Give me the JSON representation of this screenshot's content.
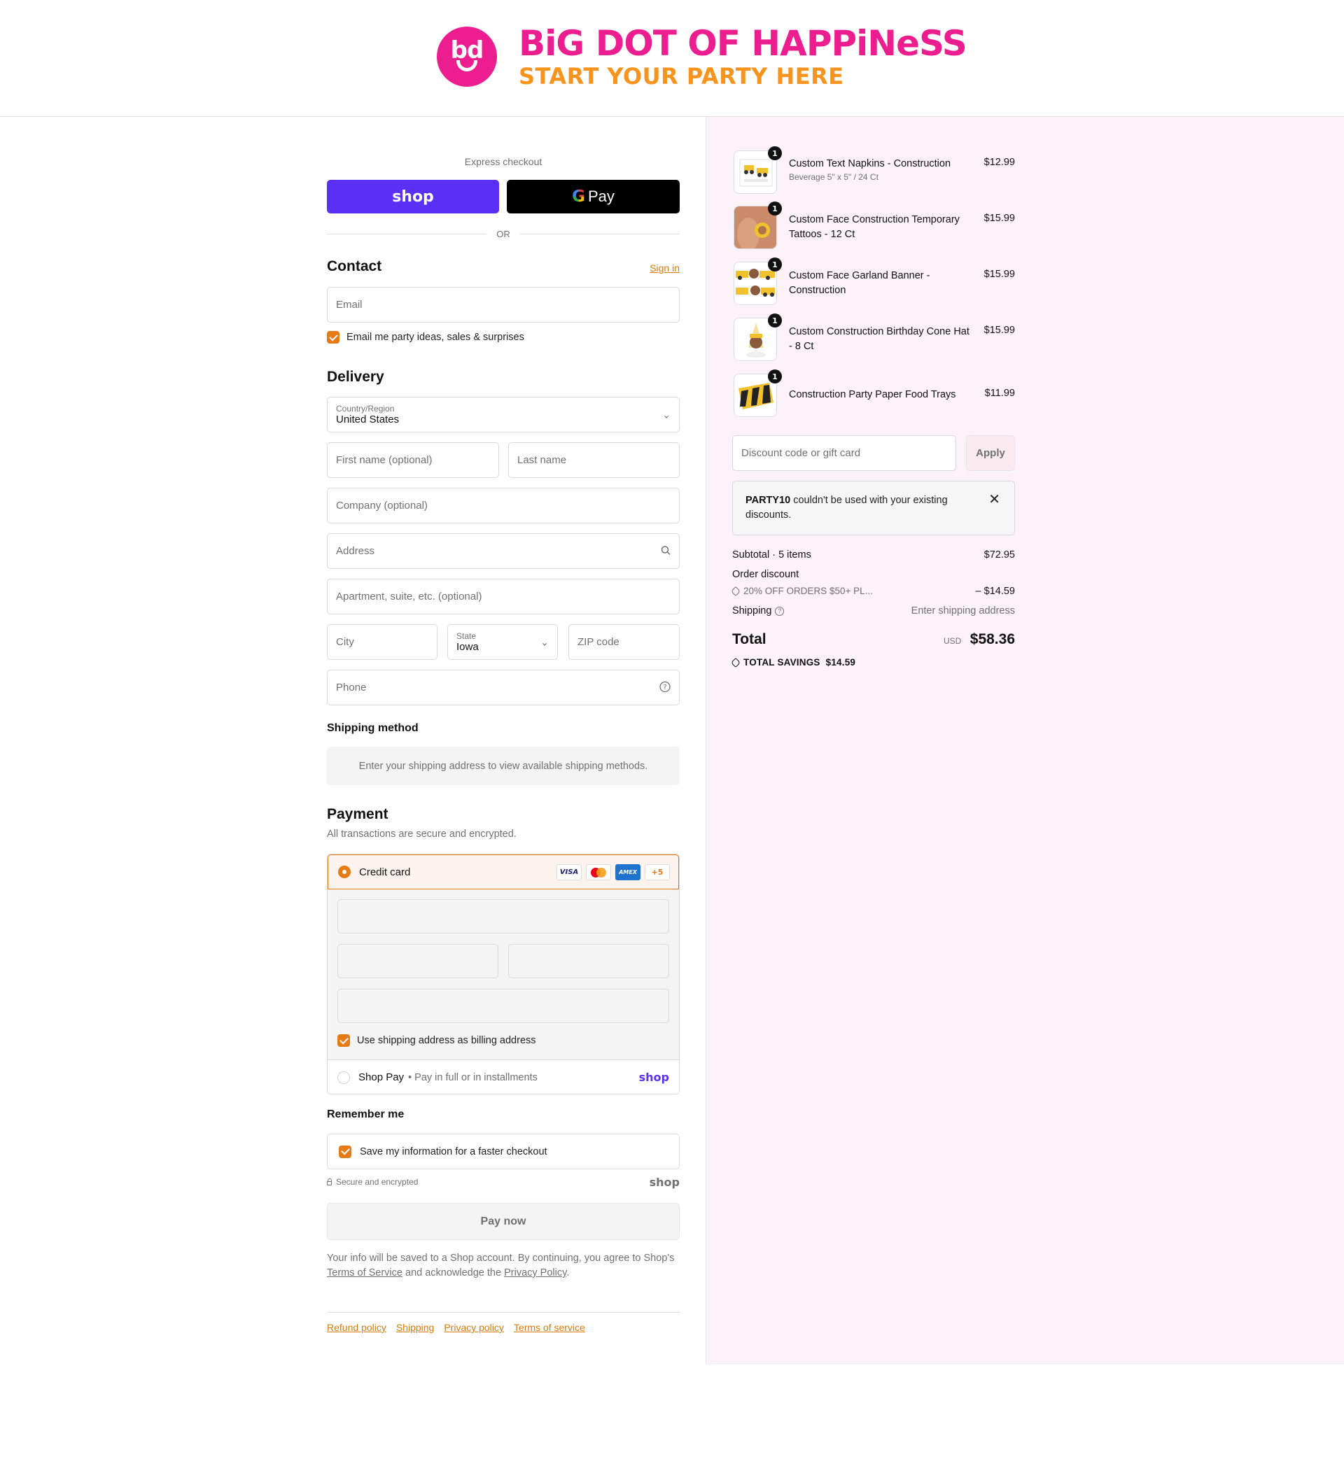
{
  "brand": {
    "logo_mark": "bd",
    "title": "BiG DOT OF HAPPiNeSS",
    "tagline": "START YOUR PARTY HERE",
    "pink": "#ec1e8f",
    "orange": "#f7941d"
  },
  "express": {
    "label": "Express checkout",
    "shop_button": "shop",
    "gpay_button": "Pay",
    "or": "OR"
  },
  "contact": {
    "heading": "Contact",
    "sign_in": "Sign in",
    "email_placeholder": "Email",
    "marketing_opt_in": "Email me party ideas, sales & surprises"
  },
  "delivery": {
    "heading": "Delivery",
    "country_label": "Country/Region",
    "country_value": "United States",
    "first_name": "First name (optional)",
    "last_name": "Last name",
    "company": "Company (optional)",
    "address": "Address",
    "apartment": "Apartment, suite, etc. (optional)",
    "city": "City",
    "state_label": "State",
    "state_value": "Iowa",
    "zip": "ZIP code",
    "phone": "Phone"
  },
  "shipping_method": {
    "heading": "Shipping method",
    "message": "Enter your shipping address to view available shipping methods."
  },
  "payment": {
    "heading": "Payment",
    "subtitle": "All transactions are secure and encrypted.",
    "credit_card": "Credit card",
    "cards": [
      "VISA",
      "mastercard",
      "AMEX",
      "+5"
    ],
    "billing_same": "Use shipping address as billing address",
    "shop_pay": "Shop Pay",
    "shop_pay_desc": "Pay in full or in installments",
    "shop_wordmark": "shop"
  },
  "remember": {
    "heading": "Remember me",
    "save_info": "Save my information for a faster checkout",
    "secure": "Secure and encrypted",
    "shop_wordmark": "shop"
  },
  "pay_now": "Pay now",
  "legal": {
    "prefix": "Your info will be saved to a Shop account. By continuing, you agree to Shop's ",
    "terms": "Terms of Service",
    "middle": " and acknowledge the ",
    "privacy": "Privacy Policy",
    "suffix": "."
  },
  "footer_links": [
    "Refund policy",
    "Shipping",
    "Privacy policy",
    "Terms of service"
  ],
  "cart": {
    "items": [
      {
        "name": "Custom Text Napkins - Construction",
        "variant": "Beverage 5\" x 5\" / 24 Ct",
        "price": "$12.99",
        "qty": "1"
      },
      {
        "name": "Custom Face Construction Temporary Tattoos - 12 Ct",
        "variant": "",
        "price": "$15.99",
        "qty": "1"
      },
      {
        "name": "Custom Face Garland Banner - Construction",
        "variant": "",
        "price": "$15.99",
        "qty": "1"
      },
      {
        "name": "Custom Construction Birthday Cone Hat - 8 Ct",
        "variant": "",
        "price": "$15.99",
        "qty": "1"
      },
      {
        "name": "Construction Party Paper Food Trays",
        "variant": "",
        "price": "$11.99",
        "qty": "1"
      }
    ],
    "discount_placeholder": "Discount code or gift card",
    "apply": "Apply",
    "notice_code": "PARTY10",
    "notice_text": " couldn't be used with your existing discounts.",
    "subtotal_label": "Subtotal · 5 items",
    "subtotal_value": "$72.95",
    "order_discount_label": "Order discount",
    "discount_code": "20% OFF ORDERS $50+ PL...",
    "discount_value": "– $14.59",
    "shipping_label": "Shipping",
    "shipping_value": "Enter shipping address",
    "total_label": "Total",
    "currency": "USD",
    "total_value": "$58.36",
    "savings_label": "TOTAL SAVINGS",
    "savings_value": "$14.59"
  }
}
